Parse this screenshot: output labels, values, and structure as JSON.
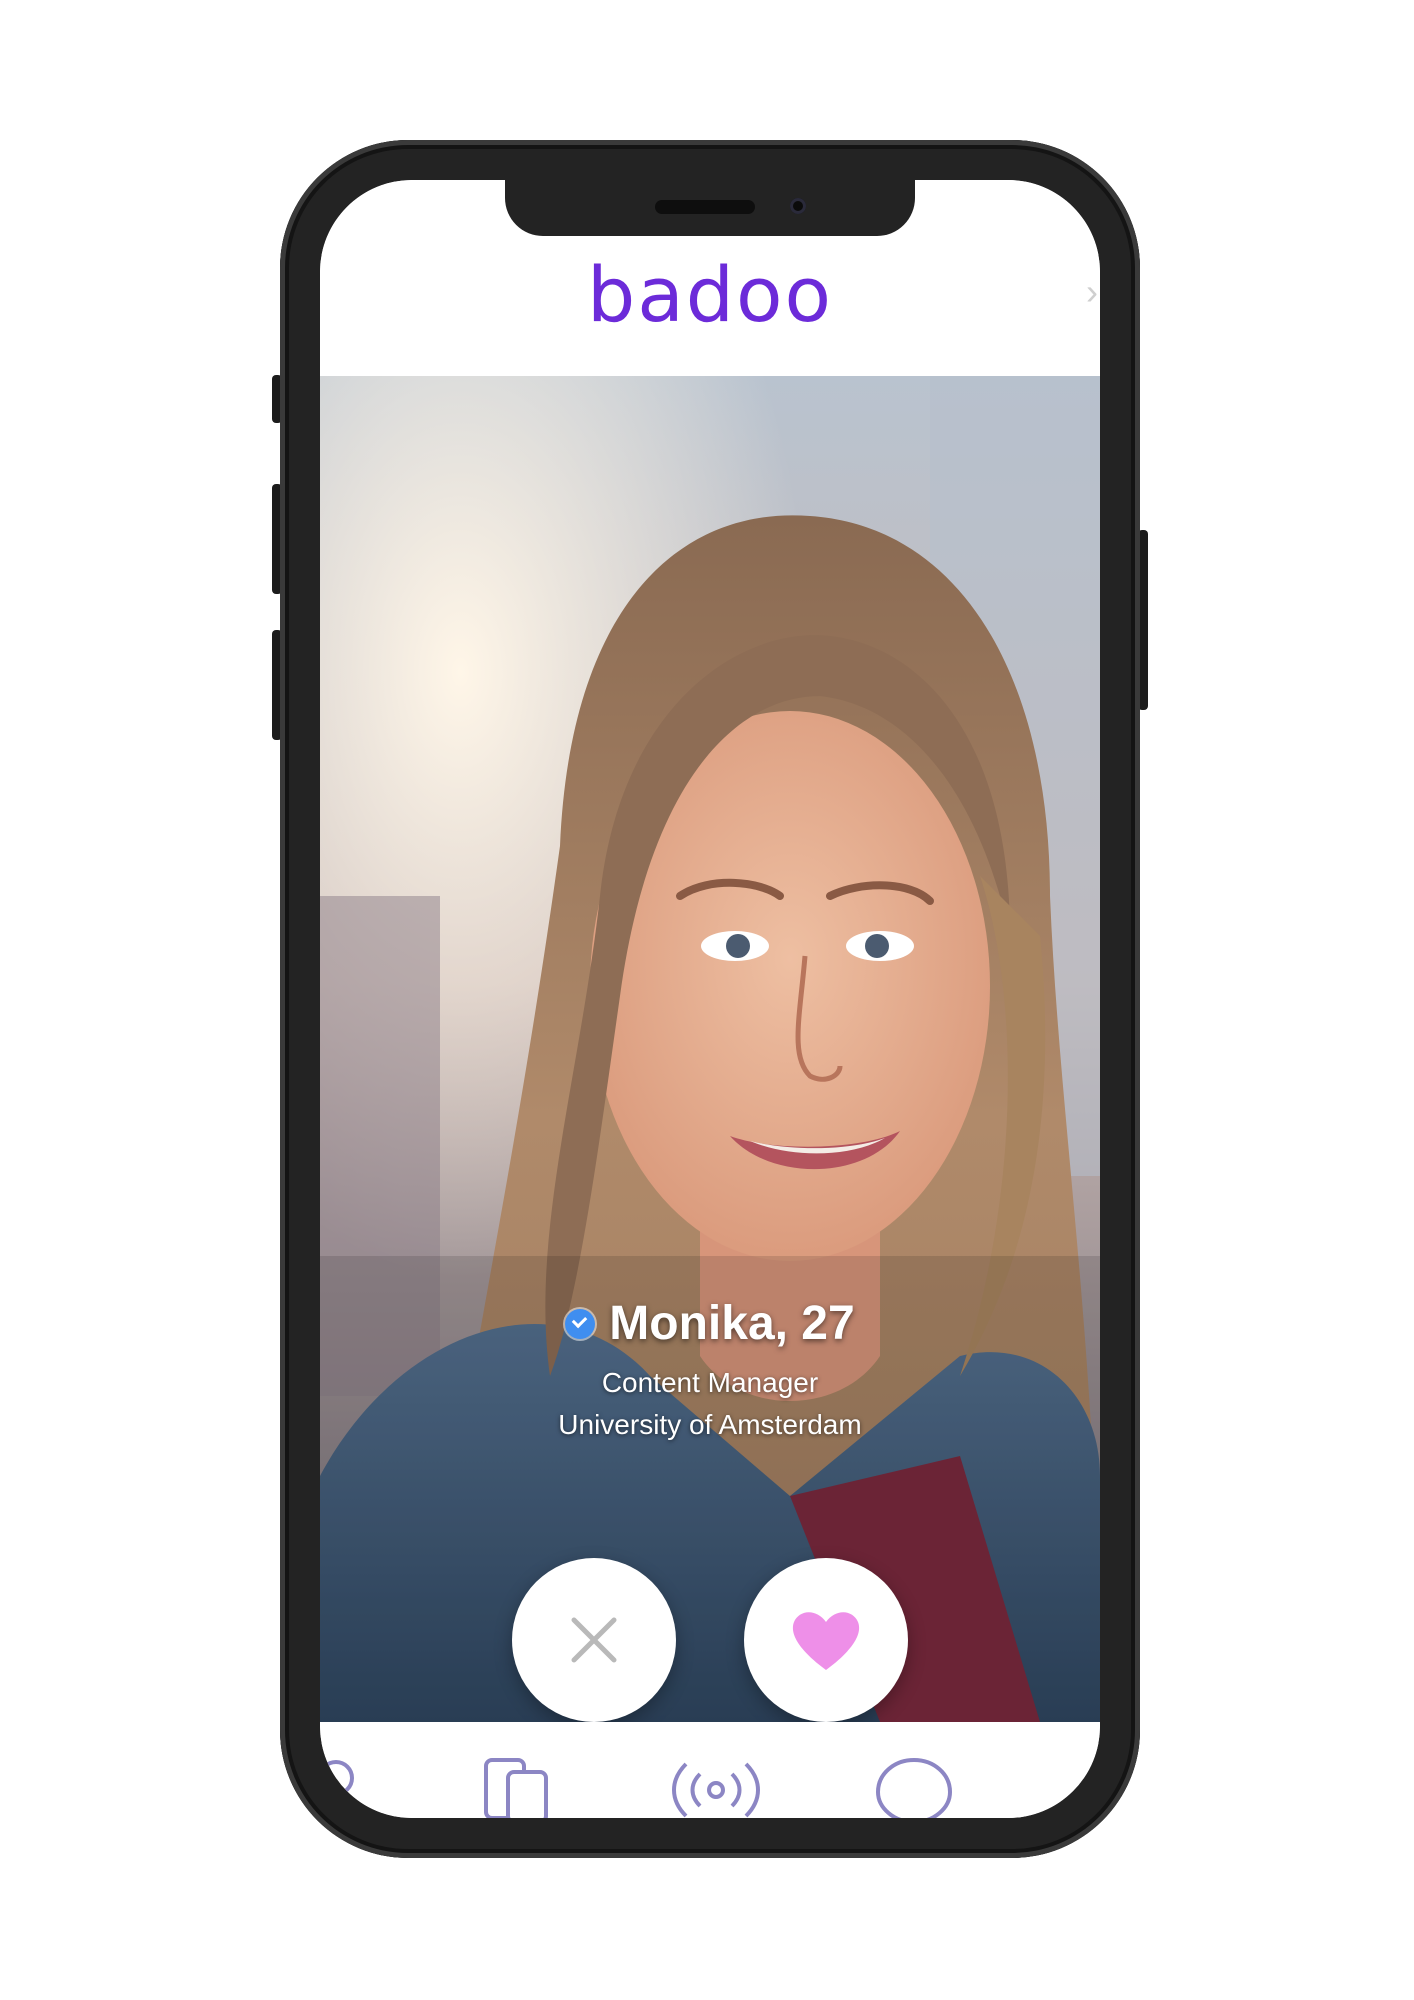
{
  "app": {
    "brand": "badoo",
    "brand_color": "#6c2bd9"
  },
  "profile": {
    "name_age": "Monika, 27",
    "verified": true,
    "verified_color": "#3f8ef0",
    "job": "Content Manager",
    "school": "University of Amsterdam"
  },
  "actions": {
    "pass_icon": "close-icon",
    "like_icon": "heart-icon",
    "like_color": "#ee8fe8"
  },
  "bottom_nav": {
    "items": [
      {
        "icon": "people-nearby-icon"
      },
      {
        "icon": "encounters-cards-icon"
      },
      {
        "icon": "live-broadcast-icon"
      },
      {
        "icon": "chat-bubble-icon"
      }
    ],
    "icon_color": "#8c86c4"
  }
}
